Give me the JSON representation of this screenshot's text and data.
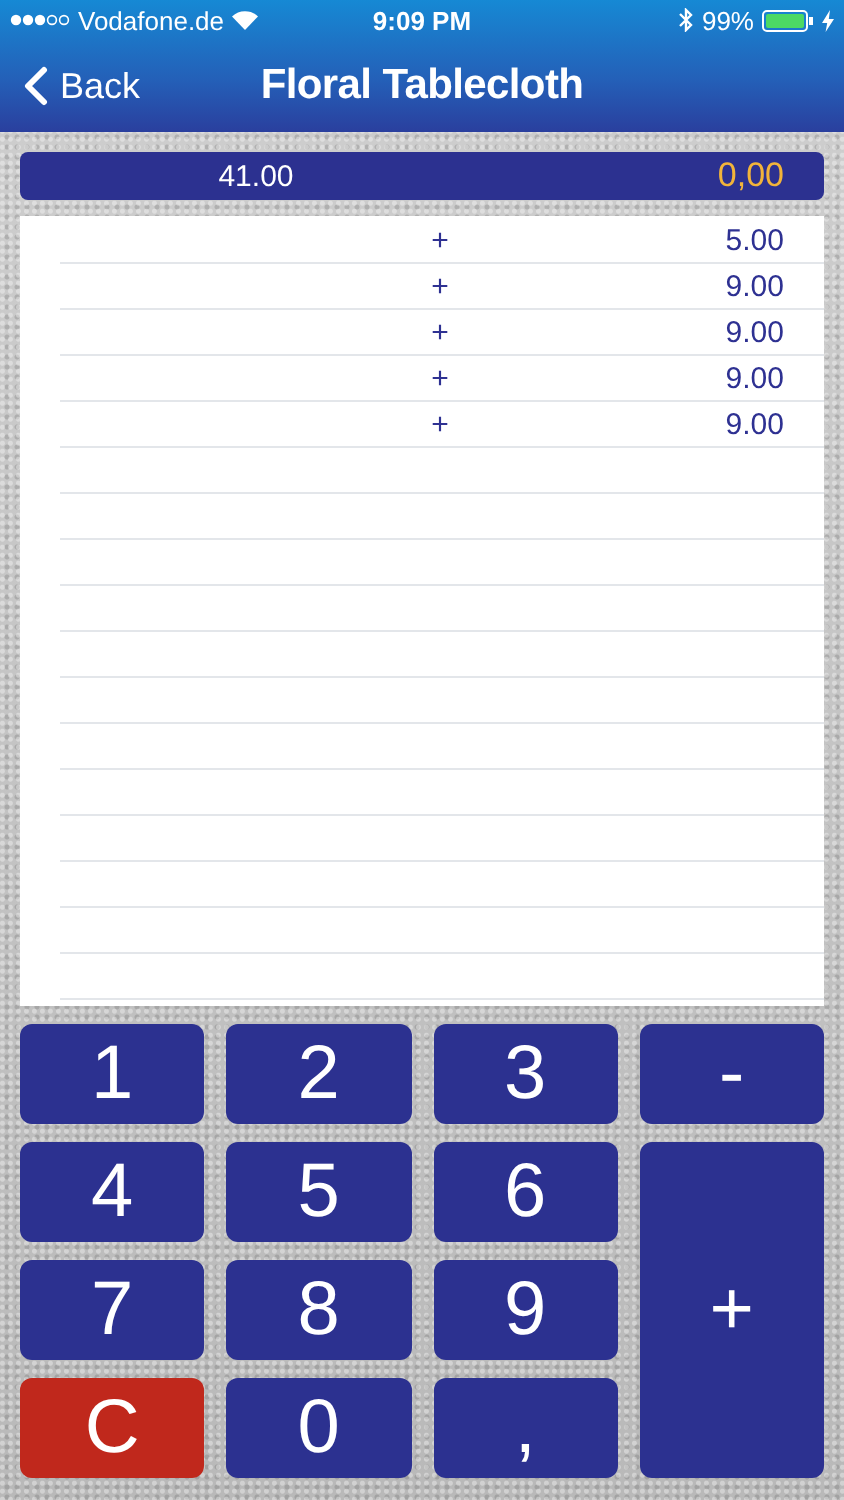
{
  "status_bar": {
    "carrier": "Vodafone.de",
    "time": "9:09 PM",
    "battery": "99%"
  },
  "nav": {
    "back": "Back",
    "title": "Floral Tablecloth"
  },
  "display": {
    "total": "41.00",
    "input": "0,00"
  },
  "tape": [
    {
      "op": "+",
      "amount": "5.00"
    },
    {
      "op": "+",
      "amount": "9.00"
    },
    {
      "op": "+",
      "amount": "9.00"
    },
    {
      "op": "+",
      "amount": "9.00"
    },
    {
      "op": "+",
      "amount": "9.00"
    }
  ],
  "keypad": [
    {
      "label": "1",
      "kind": "digit"
    },
    {
      "label": "2",
      "kind": "digit"
    },
    {
      "label": "3",
      "kind": "digit"
    },
    {
      "label": "-",
      "kind": "minus"
    },
    {
      "label": "4",
      "kind": "digit"
    },
    {
      "label": "5",
      "kind": "digit"
    },
    {
      "label": "6",
      "kind": "digit"
    },
    {
      "label": "7",
      "kind": "digit"
    },
    {
      "label": "8",
      "kind": "digit"
    },
    {
      "label": "9",
      "kind": "digit"
    },
    {
      "label": "+",
      "kind": "plus"
    },
    {
      "label": "C",
      "kind": "clear"
    },
    {
      "label": "0",
      "kind": "digit"
    },
    {
      "label": ",",
      "kind": "comma"
    }
  ]
}
